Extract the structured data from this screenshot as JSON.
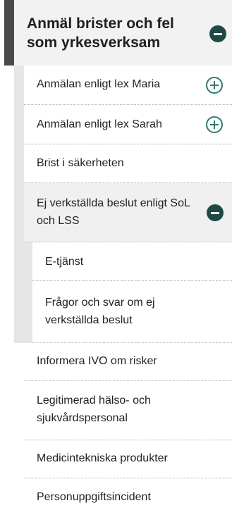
{
  "menu": {
    "title": "Anmäl brister och fel som yrkesverksam",
    "items": [
      {
        "label": "Anmälan enligt lex Maria"
      },
      {
        "label": "Anmälan enligt lex Sarah"
      },
      {
        "label": "Brist i säkerheten"
      },
      {
        "label": "Ej verkställda beslut enligt SoL och LSS"
      }
    ],
    "subitems": [
      {
        "label": "E-tjänst"
      },
      {
        "label": "Frågor och svar om ej verkställda beslut"
      }
    ],
    "lower_items": [
      {
        "label": "Informera IVO om risker"
      },
      {
        "label": "Legitimerad hälso- och sjukvårdspersonal"
      },
      {
        "label": "Medicintekniska produkter"
      },
      {
        "label": "Personuppgiftsincident"
      }
    ]
  },
  "icons": {
    "collapse": "minus-circle-icon",
    "expand": "plus-circle-icon"
  },
  "colors": {
    "accent_dark": "#1d4b44",
    "accent_outline": "#2f7a6e",
    "panel_bg": "#f2f2f2",
    "gutter": "#e6e6e6"
  }
}
